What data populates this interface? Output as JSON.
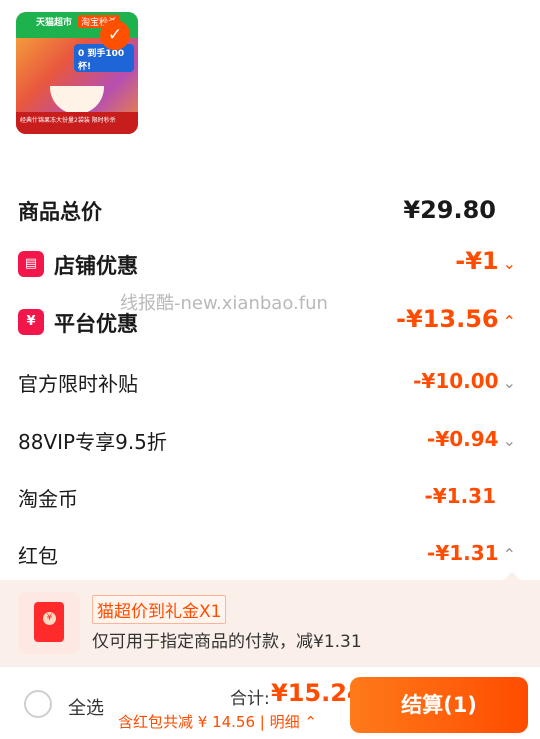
{
  "product": {
    "tmall_tag": "天猫超市",
    "taobao_tag": "淘宝秒杀",
    "banner_text": "0 到手100杯!",
    "bottom_text": "经典什锦果冻大份量2袋装 限时秒杀",
    "check_icon": "check-icon"
  },
  "summary": {
    "total_label": "商品总价",
    "total_value": "¥29.80"
  },
  "discounts": [
    {
      "label": "店铺优惠",
      "value": "-¥1",
      "chev": "⌄",
      "icon": "store-icon"
    },
    {
      "label": "平台优惠",
      "value": "-¥13.56",
      "chev": "⌃",
      "icon": "platform-icon"
    },
    {
      "label": "官方限时补贴",
      "value": "-¥10.00",
      "chev": "⌄"
    },
    {
      "label": "88VIP专享9.5折",
      "value": "-¥0.94",
      "chev": "⌄"
    },
    {
      "label": "淘金币",
      "value": "-¥1.31",
      "chev": ""
    },
    {
      "label": "红包",
      "value": "-¥1.31",
      "chev": "⌃"
    }
  ],
  "watermark": "线报酷-new.xianbao.fun",
  "coupon": {
    "tag": "猫超价到礼金X1",
    "desc": "仅可用于指定商品的付款，减¥1.31",
    "yen": "¥"
  },
  "footer": {
    "select_all": "全选",
    "sum_label": "合计:",
    "sum_value": "¥15.24",
    "saving": "含红包共减 ¥ 14.56 | 明细 ⌃",
    "checkout": "结算(1)"
  },
  "colors": {
    "accent": "#ff4c00",
    "icon_red": "#f3164a"
  }
}
